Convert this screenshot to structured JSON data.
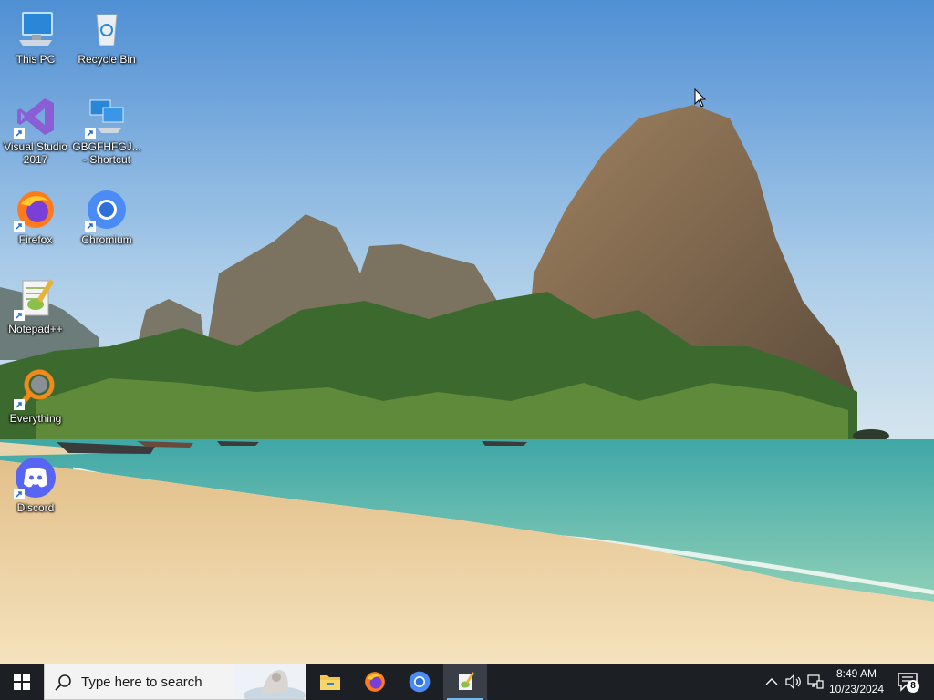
{
  "desktop": {
    "icons": [
      {
        "label": "This PC",
        "icon": "computer-icon",
        "shortcut": false
      },
      {
        "label": "Recycle Bin",
        "icon": "recycle-bin-icon",
        "shortcut": false
      },
      {
        "label": "Visual Studio 2017",
        "icon": "visual-studio-icon",
        "shortcut": true
      },
      {
        "label": "GBGFHFGJ... - Shortcut",
        "icon": "network-computer-icon",
        "shortcut": true
      },
      {
        "label": "Firefox",
        "icon": "firefox-icon",
        "shortcut": true
      },
      {
        "label": "Chromium",
        "icon": "chromium-icon",
        "shortcut": true
      },
      {
        "label": "Notepad++",
        "icon": "notepadpp-icon",
        "shortcut": true
      },
      {
        "label": "Everything",
        "icon": "everything-search-icon",
        "shortcut": true
      },
      {
        "label": "Discord",
        "icon": "discord-icon",
        "shortcut": true
      }
    ]
  },
  "taskbar": {
    "start_icon": "windows-logo-icon",
    "search_placeholder": "Type here to search",
    "pinned": [
      {
        "name": "File Explorer",
        "icon": "file-explorer-icon",
        "active": false
      },
      {
        "name": "Firefox",
        "icon": "firefox-icon",
        "active": false
      },
      {
        "name": "Chromium",
        "icon": "chromium-icon",
        "active": false
      },
      {
        "name": "Notepad++",
        "icon": "notepadpp-icon",
        "active": true
      }
    ],
    "tray": {
      "icons": [
        "chevron-up-icon",
        "speaker-icon",
        "network-icon"
      ],
      "time": "8:49 AM",
      "date": "10/23/2024",
      "notification_count": "8"
    }
  },
  "colors": {
    "taskbar": "#1c1f24",
    "active_indicator": "#76b9ed",
    "sky": "#6ea2d8",
    "sea": "#47b3a5",
    "sand": "#f0d9ac"
  }
}
